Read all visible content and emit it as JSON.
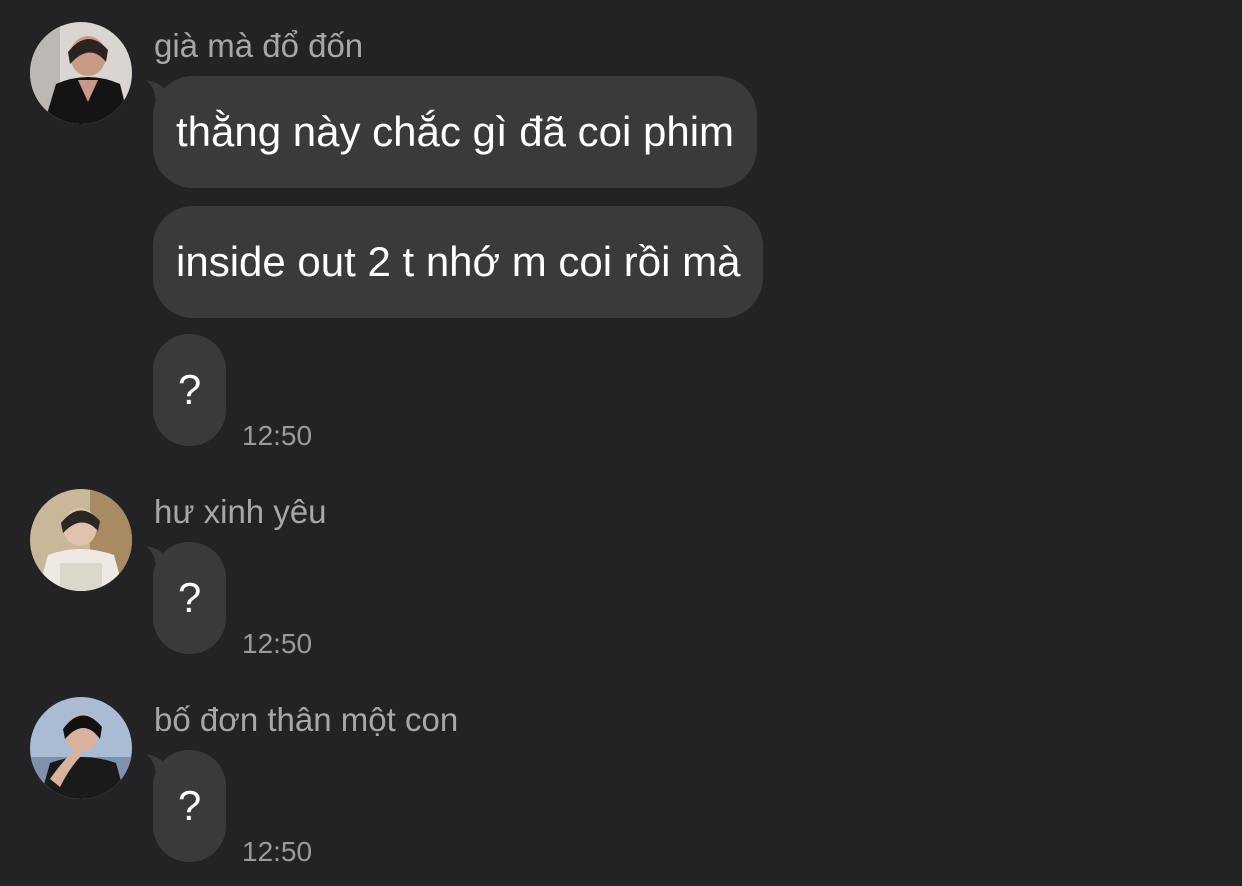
{
  "messages": [
    {
      "sender": "già mà đổ đốn",
      "avatar": "avatar-man-black-jacket",
      "bubbles": [
        "thằng này chắc gì đã coi phim",
        "inside out 2 t nhớ m coi rồi mà",
        "?"
      ],
      "time": "12:50"
    },
    {
      "sender": "hư xinh yêu",
      "avatar": "avatar-man-white-jacket",
      "bubbles": [
        "?"
      ],
      "time": "12:50"
    },
    {
      "sender": "bố đơn thân một con",
      "avatar": "avatar-man-black-shirt",
      "bubbles": [
        "?"
      ],
      "time": "12:50"
    }
  ],
  "colors": {
    "background": "#232325",
    "bubble": "#3a3a3c",
    "text": "#ffffff",
    "meta": "#a7a7aa"
  }
}
